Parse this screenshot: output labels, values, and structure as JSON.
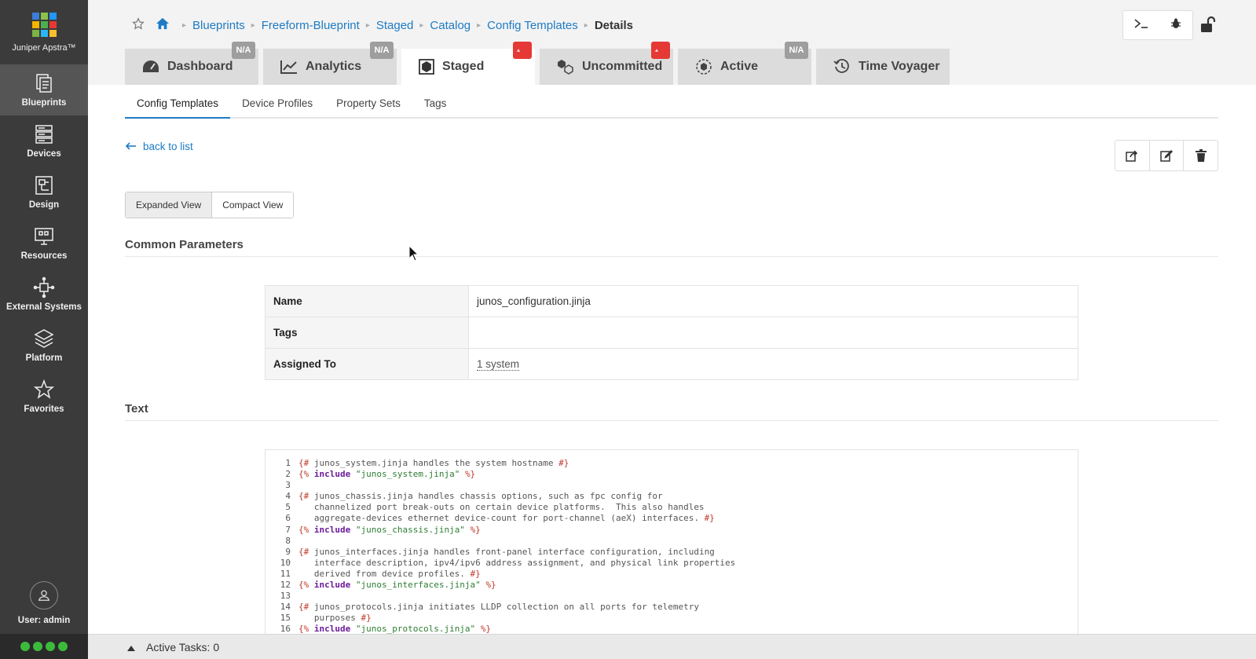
{
  "app": {
    "brand_name": "Juniper Apstra™",
    "brand_colors": [
      "#3b7dd8",
      "#8bc34a",
      "#2196f3",
      "#f4b400",
      "#4caf50",
      "#e53935",
      "#7cb342",
      "#29b6f6",
      "#fbc02d"
    ]
  },
  "sidebar": {
    "items": [
      {
        "label": "Blueprints",
        "icon": "blueprints-icon"
      },
      {
        "label": "Devices",
        "icon": "devices-icon"
      },
      {
        "label": "Design",
        "icon": "design-icon"
      },
      {
        "label": "Resources",
        "icon": "resources-icon"
      },
      {
        "label": "External Systems",
        "icon": "external-systems-icon"
      },
      {
        "label": "Platform",
        "icon": "platform-icon"
      },
      {
        "label": "Favorites",
        "icon": "star-icon"
      }
    ],
    "user_label": "User: admin"
  },
  "breadcrumb": [
    "Blueprints",
    "Freeform-Blueprint",
    "Staged",
    "Catalog",
    "Config Templates",
    "Details"
  ],
  "tabs": [
    {
      "label": "Dashboard",
      "badge": "N/A"
    },
    {
      "label": "Analytics",
      "badge": "N/A"
    },
    {
      "label": "Staged",
      "badge": "!"
    },
    {
      "label": "Uncommitted",
      "badge": "!"
    },
    {
      "label": "Active",
      "badge": "N/A"
    },
    {
      "label": "Time Voyager",
      "badge": ""
    }
  ],
  "subtabs": [
    "Config Templates",
    "Device Profiles",
    "Property Sets",
    "Tags"
  ],
  "back_link": "back to list",
  "view_toggle": {
    "expanded": "Expanded View",
    "compact": "Compact View"
  },
  "sections": {
    "common": "Common Parameters",
    "text": "Text"
  },
  "params": {
    "name_key": "Name",
    "name_value": "junos_configuration.jinja",
    "tags_key": "Tags",
    "tags_value": "",
    "assigned_key": "Assigned To",
    "assigned_value": "1 system"
  },
  "code": {
    "lines": [
      {
        "n": "1",
        "parts": [
          [
            "br",
            "{#"
          ],
          [
            "cm",
            " junos_system.jinja handles the system hostname "
          ],
          [
            "br",
            "#}"
          ]
        ]
      },
      {
        "n": "2",
        "parts": [
          [
            "br",
            "{%"
          ],
          [
            "cm",
            " "
          ],
          [
            "kw",
            "include"
          ],
          [
            "cm",
            " "
          ],
          [
            "st",
            "\"junos_system.jinja\""
          ],
          [
            "cm",
            " "
          ],
          [
            "br",
            "%}"
          ]
        ]
      },
      {
        "n": "3",
        "parts": []
      },
      {
        "n": "4",
        "parts": [
          [
            "br",
            "{#"
          ],
          [
            "cm",
            " junos_chassis.jinja handles chassis options, such as fpc config for"
          ]
        ]
      },
      {
        "n": "5",
        "parts": [
          [
            "cm",
            "   channelized port break-outs on certain device platforms.  This also handles"
          ]
        ]
      },
      {
        "n": "6",
        "parts": [
          [
            "cm",
            "   aggregate-devices ethernet device-count for port-channel (aeX) interfaces. "
          ],
          [
            "br",
            "#}"
          ]
        ]
      },
      {
        "n": "7",
        "parts": [
          [
            "br",
            "{%"
          ],
          [
            "cm",
            " "
          ],
          [
            "kw",
            "include"
          ],
          [
            "cm",
            " "
          ],
          [
            "st",
            "\"junos_chassis.jinja\""
          ],
          [
            "cm",
            " "
          ],
          [
            "br",
            "%}"
          ]
        ]
      },
      {
        "n": "8",
        "parts": []
      },
      {
        "n": "9",
        "parts": [
          [
            "br",
            "{#"
          ],
          [
            "cm",
            " junos_interfaces.jinja handles front-panel interface configuration, including"
          ]
        ]
      },
      {
        "n": "10",
        "parts": [
          [
            "cm",
            "   interface description, ipv4/ipv6 address assignment, and physical link properties"
          ]
        ]
      },
      {
        "n": "11",
        "parts": [
          [
            "cm",
            "   derived from device profiles. "
          ],
          [
            "br",
            "#}"
          ]
        ]
      },
      {
        "n": "12",
        "parts": [
          [
            "br",
            "{%"
          ],
          [
            "cm",
            " "
          ],
          [
            "kw",
            "include"
          ],
          [
            "cm",
            " "
          ],
          [
            "st",
            "\"junos_interfaces.jinja\""
          ],
          [
            "cm",
            " "
          ],
          [
            "br",
            "%}"
          ]
        ]
      },
      {
        "n": "13",
        "parts": []
      },
      {
        "n": "14",
        "parts": [
          [
            "br",
            "{#"
          ],
          [
            "cm",
            " junos_protocols.jinja initiates LLDP collection on all ports for telemetry"
          ]
        ]
      },
      {
        "n": "15",
        "parts": [
          [
            "cm",
            "   purposes "
          ],
          [
            "br",
            "#}"
          ]
        ]
      },
      {
        "n": "16",
        "parts": [
          [
            "br",
            "{%"
          ],
          [
            "cm",
            " "
          ],
          [
            "kw",
            "include"
          ],
          [
            "cm",
            " "
          ],
          [
            "st",
            "\"junos_protocols.jinja\""
          ],
          [
            "cm",
            " "
          ],
          [
            "br",
            "%}"
          ]
        ]
      }
    ]
  },
  "bottom_bar": {
    "label": "Active Tasks: 0"
  },
  "colors": {
    "accent": "#1e7bc4",
    "sidebar": "#3b3b3b",
    "warning": "#e53935",
    "status_ok": "#3cba3c"
  }
}
